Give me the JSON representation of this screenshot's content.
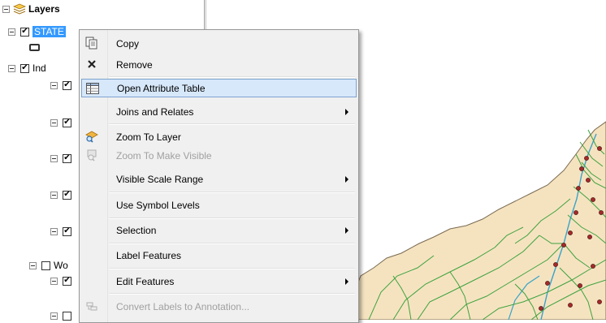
{
  "toc": {
    "root_label": "Layers",
    "rows": [
      {
        "label": "STATE",
        "checked": true
      },
      {
        "label": "Ind",
        "checked": true
      },
      {
        "label": "",
        "checked": true
      },
      {
        "label": "",
        "checked": true
      },
      {
        "label": "",
        "checked": true
      },
      {
        "label": "",
        "checked": true
      },
      {
        "label": "",
        "checked": true
      },
      {
        "label": "Wo",
        "checked": false
      },
      {
        "label": "",
        "checked": true
      },
      {
        "label": "",
        "checked": false
      }
    ]
  },
  "context_menu": {
    "items": [
      {
        "label": "Copy",
        "icon": "copy-icon",
        "enabled": true,
        "submenu": false
      },
      {
        "label": "Remove",
        "icon": "remove-icon",
        "enabled": true,
        "submenu": false
      },
      {
        "label": "Open Attribute Table",
        "icon": "table-icon",
        "enabled": true,
        "submenu": false,
        "highlighted": true
      },
      {
        "label": "Joins and Relates",
        "icon": "",
        "enabled": true,
        "submenu": true
      },
      {
        "label": "Zoom To Layer",
        "icon": "zoom-layer-icon",
        "enabled": true,
        "submenu": false
      },
      {
        "label": "Zoom To Make Visible",
        "icon": "zoom-visible-icon",
        "enabled": false,
        "submenu": false
      },
      {
        "label": "Visible Scale Range",
        "icon": "",
        "enabled": true,
        "submenu": true
      },
      {
        "label": "Use Symbol Levels",
        "icon": "",
        "enabled": true,
        "submenu": false
      },
      {
        "label": "Selection",
        "icon": "",
        "enabled": true,
        "submenu": true
      },
      {
        "label": "Label Features",
        "icon": "",
        "enabled": true,
        "submenu": false
      },
      {
        "label": "Edit Features",
        "icon": "",
        "enabled": true,
        "submenu": true
      },
      {
        "label": "Convert Labels to Annotation...",
        "icon": "convert-labels-icon",
        "enabled": false,
        "submenu": false
      }
    ]
  },
  "colors": {
    "land": "#f5e3c0",
    "roads": "#3fa23f",
    "rivers": "#3aa3c7",
    "points": "#a52a2a",
    "highlight_bg": "#d7e8fb",
    "highlight_border": "#7da2ce",
    "selected_label": "#3399ff"
  }
}
